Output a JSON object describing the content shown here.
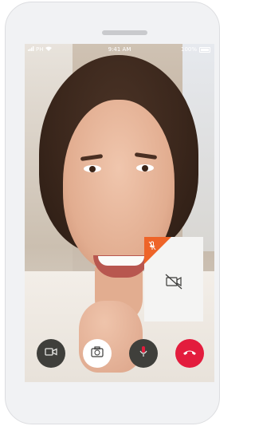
{
  "status_bar": {
    "carrier": "PH",
    "time": "9:41 AM",
    "battery": "100%"
  },
  "self_view": {
    "muted_icon": "mic-off-icon",
    "camera_icon": "video-off-icon",
    "accent_color": "#ee6428"
  },
  "controls": {
    "video": {
      "icon": "video-camera-icon",
      "color": "#3f3f3b"
    },
    "switch_camera": {
      "icon": "switch-camera-icon",
      "color": "#ffffff"
    },
    "microphone": {
      "icon": "microphone-icon",
      "color": "#3f3f3b"
    },
    "end_call": {
      "icon": "hang-up-icon",
      "color": "#e31c3d"
    }
  }
}
